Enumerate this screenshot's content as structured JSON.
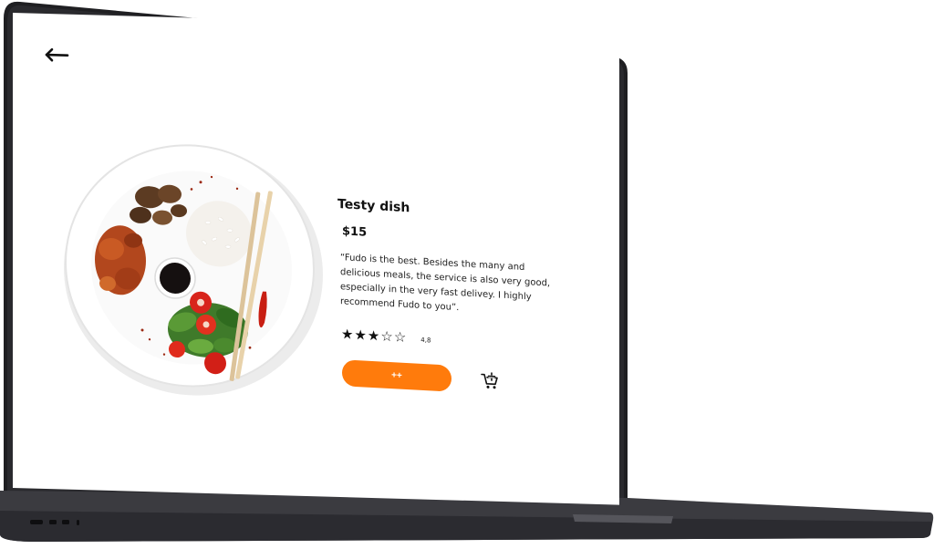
{
  "product": {
    "title": "Testy dish",
    "price": "$15",
    "review": "“Fudo is the best. Besides the many and delicious meals, the service is also very good, especially in the very  fast delivey. I highly recommend Fudo  to you”.",
    "rating": {
      "value": 3,
      "max": 5,
      "label": "4,8"
    }
  },
  "actions": {
    "add_label": "++"
  },
  "icons": {
    "back": "arrow-left-icon",
    "cart": "add-to-cart-icon",
    "star_full": "★",
    "star_empty": "☆"
  },
  "colors": {
    "accent": "#ff7b0c",
    "laptop_frame": "#1f1f22",
    "text": "#111111"
  }
}
